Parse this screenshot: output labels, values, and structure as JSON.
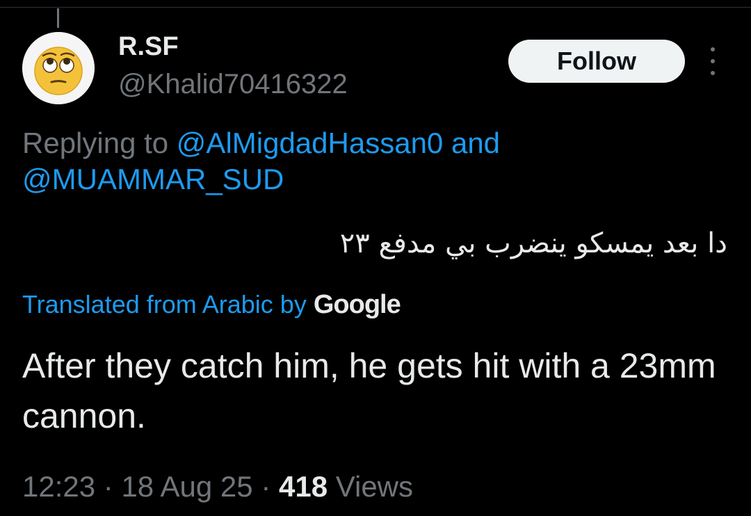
{
  "tweet": {
    "display_name": "R.SF",
    "handle": "@Khalid70416322",
    "follow_label": "Follow",
    "avatar_icon": "eye-roll-emoji-icon",
    "replying_prefix": "Replying to",
    "reply_mention_1": "@AlMigdadHassan0",
    "reply_joiner": "and",
    "reply_mention_2": "@MUAMMAR_SUD",
    "original_text": "دا بعد يمسكو ينضرب بي مدفع ٢٣",
    "translated_label": "Translated from Arabic by",
    "translated_provider": "Google",
    "translation": "After they catch him, he gets hit with a 23mm cannon.",
    "time": "12:23",
    "separator": "·",
    "date": "18 Aug 25",
    "views_count": "418",
    "views_label": "Views"
  },
  "colors": {
    "background": "#000000",
    "text_primary": "#e7e9ea",
    "text_secondary": "#71767b",
    "link_blue": "#1d9bf0",
    "follow_bg": "#eff3f4"
  }
}
